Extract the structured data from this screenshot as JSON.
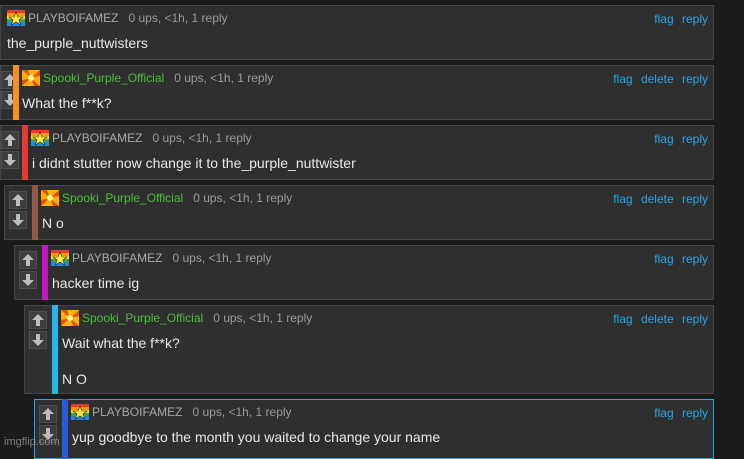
{
  "colors": {
    "background": "#1b1b1b",
    "card": "#2f2f2f",
    "link": "#2aa4e6",
    "famez_username": "#a9a9a9",
    "spooki_username": "#4cbf3a",
    "accents": [
      "#f39221",
      "#e53935",
      "#8d5a48",
      "#c019c0",
      "#27b6e8",
      "#2a5bd9"
    ]
  },
  "icons": {
    "vote_up": "up-arrow-icon",
    "vote_down": "down-arrow-icon",
    "famez_avatar": "rainbow-star-avatar",
    "spooki_avatar": "orange-burst-avatar"
  },
  "comments": [
    {
      "username": "PLAYBOIFAMEZ",
      "meta": "0 ups, <1h, 1 reply",
      "actions": [
        "flag",
        "reply"
      ],
      "lines": [
        "the_purple_nuttwisters"
      ]
    },
    {
      "username": "Spooki_Purple_Official",
      "meta": "0 ups, <1h, 1 reply",
      "actions": [
        "flag",
        "delete",
        "reply"
      ],
      "lines": [
        "What the f**k?"
      ]
    },
    {
      "username": "PLAYBOIFAMEZ",
      "meta": "0 ups, <1h, 1 reply",
      "actions": [
        "flag",
        "reply"
      ],
      "lines": [
        "i didnt stutter now change it to the_purple_nuttwister"
      ]
    },
    {
      "username": "Spooki_Purple_Official",
      "meta": "0 ups, <1h, 1 reply",
      "actions": [
        "flag",
        "delete",
        "reply"
      ],
      "lines": [
        "N o"
      ]
    },
    {
      "username": "PLAYBOIFAMEZ",
      "meta": "0 ups, <1h, 1 reply",
      "actions": [
        "flag",
        "reply"
      ],
      "lines": [
        "hacker time ig"
      ]
    },
    {
      "username": "Spooki_Purple_Official",
      "meta": "0 ups, <1h, 1 reply",
      "actions": [
        "flag",
        "delete",
        "reply"
      ],
      "lines": [
        "Wait what the f**k?",
        "N O"
      ]
    },
    {
      "username": "PLAYBOIFAMEZ",
      "meta": "0 ups, <1h, 1 reply",
      "actions": [
        "flag",
        "reply"
      ],
      "lines": [
        "yup goodbye to the month you waited to change your name"
      ]
    }
  ],
  "watermark": "imgflip.com"
}
